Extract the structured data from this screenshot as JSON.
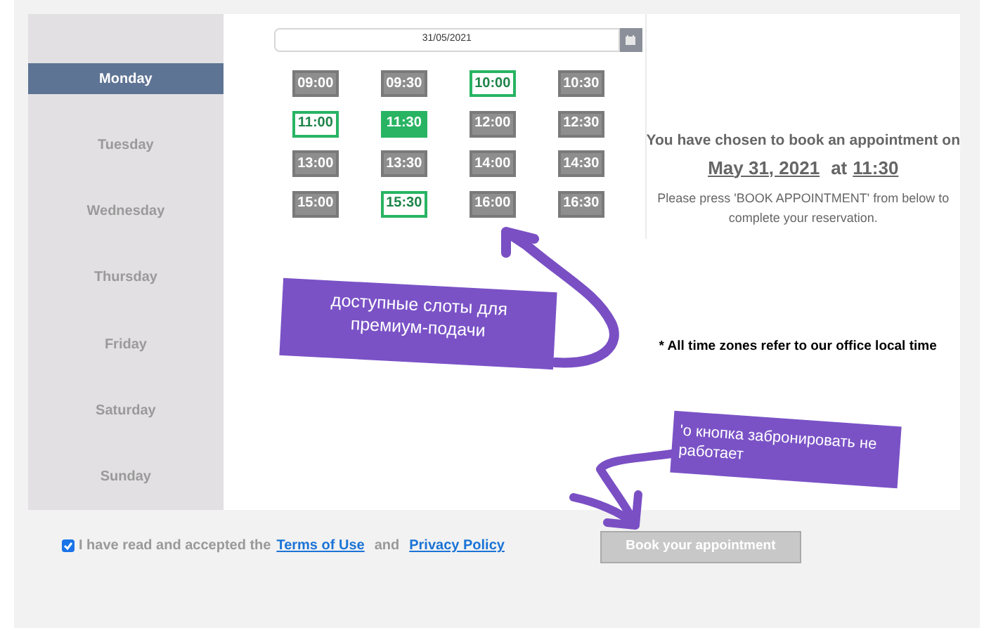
{
  "days": [
    {
      "label": "Monday",
      "selected": true
    },
    {
      "label": "Tuesday",
      "selected": false
    },
    {
      "label": "Wednesday",
      "selected": false
    },
    {
      "label": "Thursday",
      "selected": false
    },
    {
      "label": "Friday",
      "selected": false
    },
    {
      "label": "Saturday",
      "selected": false
    },
    {
      "label": "Sunday",
      "selected": false
    }
  ],
  "date_field": {
    "value": "31/05/2021"
  },
  "slots": [
    {
      "time": "09:00",
      "available": false,
      "selected": false
    },
    {
      "time": "09:30",
      "available": false,
      "selected": false
    },
    {
      "time": "10:00",
      "available": true,
      "selected": false
    },
    {
      "time": "10:30",
      "available": false,
      "selected": false
    },
    {
      "time": "11:00",
      "available": true,
      "selected": false
    },
    {
      "time": "11:30",
      "available": true,
      "selected": true
    },
    {
      "time": "12:00",
      "available": false,
      "selected": false
    },
    {
      "time": "12:30",
      "available": false,
      "selected": false
    },
    {
      "time": "13:00",
      "available": false,
      "selected": false
    },
    {
      "time": "13:30",
      "available": false,
      "selected": false
    },
    {
      "time": "14:00",
      "available": false,
      "selected": false
    },
    {
      "time": "14:30",
      "available": false,
      "selected": false
    },
    {
      "time": "15:00",
      "available": false,
      "selected": false
    },
    {
      "time": "15:30",
      "available": true,
      "selected": false
    },
    {
      "time": "16:00",
      "available": false,
      "selected": false
    },
    {
      "time": "16:30",
      "available": false,
      "selected": false
    }
  ],
  "summary": {
    "heading": "You have chosen to book an appointment on",
    "date": "May 31, 2021",
    "at": "at",
    "time": "11:30",
    "instruction": "Please press 'BOOK APPOINTMENT' from below to complete your reservation."
  },
  "timezone_note": "* All time zones refer to our office local time",
  "consent": {
    "checked": true,
    "text": "I have read and accepted the",
    "terms_link": "Terms of Use",
    "and": "and",
    "privacy_link": "Privacy Policy"
  },
  "book_button": {
    "label": "Book your appointment",
    "disabled": true
  },
  "annotations": [
    {
      "text": "доступные слоты для премиум-подачи"
    },
    {
      "text": "'о кнопка забронировать не работает"
    }
  ]
}
